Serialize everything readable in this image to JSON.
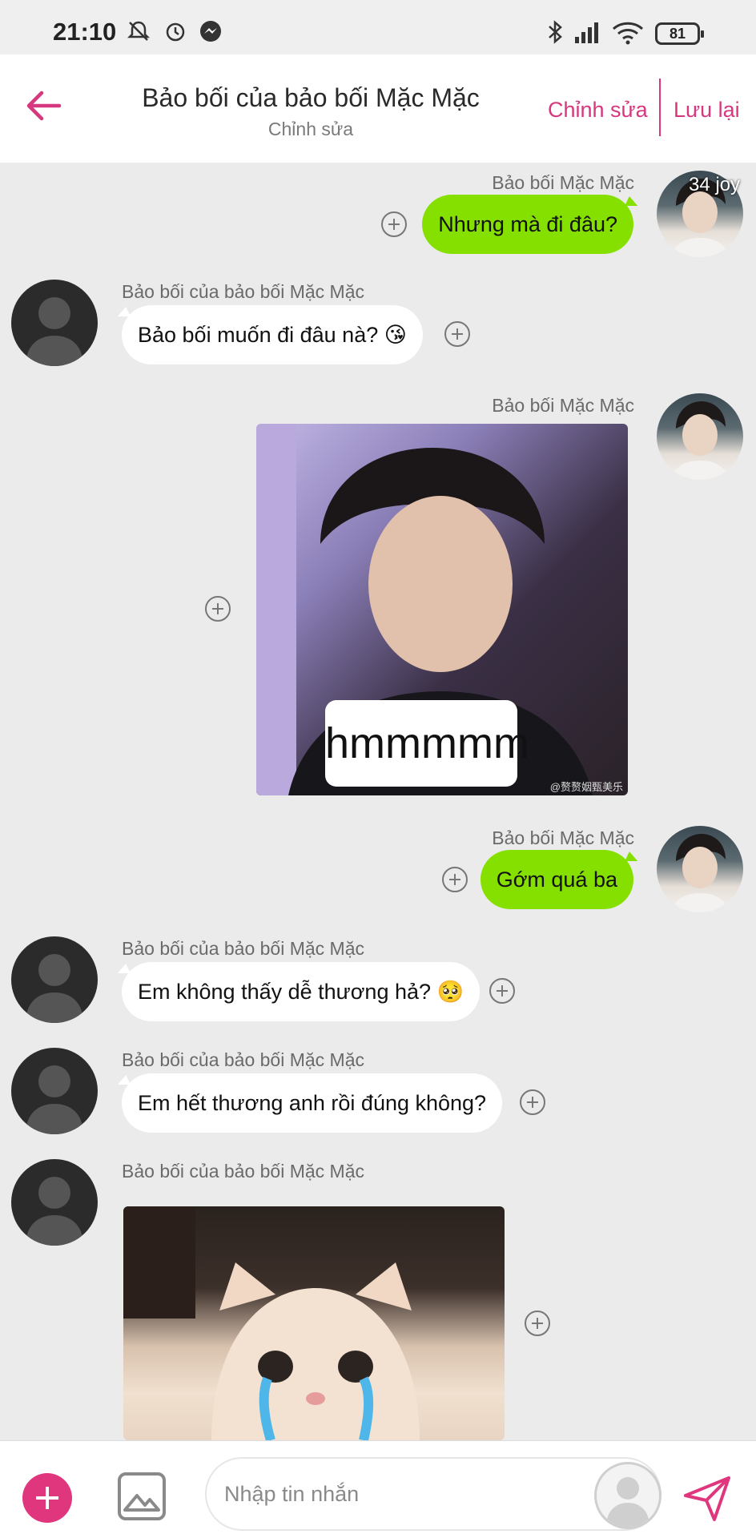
{
  "status_bar": {
    "time": "21:10",
    "battery": "81",
    "icons": [
      "mute-icon",
      "alarm-icon",
      "messenger-icon",
      "bluetooth-icon",
      "signal-icon",
      "wifi-icon",
      "battery-icon"
    ]
  },
  "header": {
    "title": "Bảo bối của bảo bối Mặc Mặc",
    "subtitle": "Chỉnh sửa",
    "edit_label": "Chỉnh sửa",
    "save_label": "Lưu lại"
  },
  "messages": [
    {
      "side": "right",
      "sender": "Bảo bối Mặc Mặc",
      "text": "Nhưng mà đi đâu?",
      "avatar_label": "34 joy"
    },
    {
      "side": "left",
      "sender": "Bảo bối của bảo bối Mặc Mặc",
      "text": "Bảo bối muốn đi đâu nà? 😘"
    },
    {
      "side": "right",
      "sender": "Bảo bối Mặc Mặc",
      "image_caption": "hmmmmm",
      "image_watermark": "@赘赘姻甄美乐"
    },
    {
      "side": "right",
      "sender": "Bảo bối Mặc Mặc",
      "text": "Gớm quá ba"
    },
    {
      "side": "left",
      "sender": "Bảo bối của bảo bối Mặc Mặc",
      "text": "Em không thấy dễ thương hả? 🥺"
    },
    {
      "side": "left",
      "sender": "Bảo bối của bảo bối Mặc Mặc",
      "text": "Em hết thương anh rồi đúng không?"
    },
    {
      "side": "left",
      "sender": "Bảo bối của bảo bối Mặc Mặc",
      "image": "crying-cat"
    }
  ],
  "input": {
    "placeholder": "Nhập tin nhắn"
  },
  "colors": {
    "accent": "#e0367e",
    "outgoing_bubble": "#85e000",
    "incoming_bubble": "#ffffff",
    "chat_background": "#ebebeb"
  }
}
